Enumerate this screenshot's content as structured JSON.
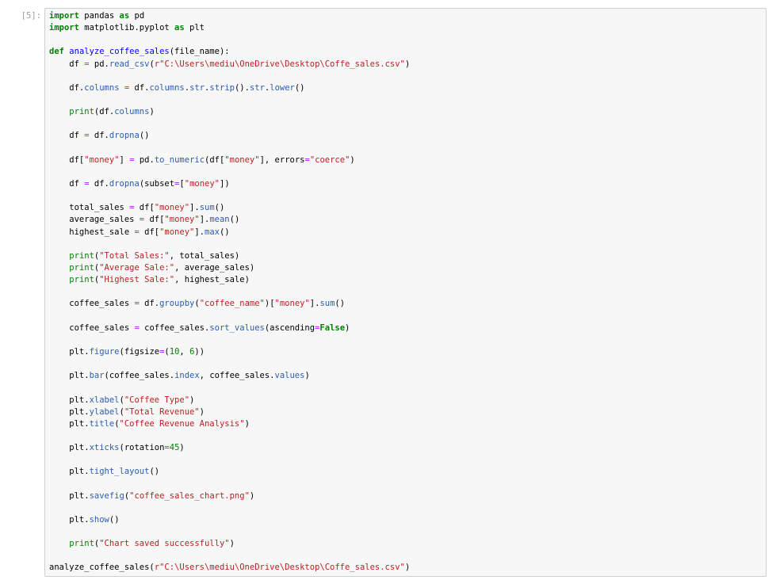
{
  "cell": {
    "prompt": "[5]:",
    "lines": [
      [
        {
          "t": "kw",
          "v": "import"
        },
        {
          "t": "tx",
          "v": " pandas "
        },
        {
          "t": "kw",
          "v": "as"
        },
        {
          "t": "tx",
          "v": " pd"
        }
      ],
      [
        {
          "t": "kw",
          "v": "import"
        },
        {
          "t": "tx",
          "v": " matplotlib.pyplot "
        },
        {
          "t": "kw",
          "v": "as"
        },
        {
          "t": "tx",
          "v": " plt"
        }
      ],
      [],
      [
        {
          "t": "kw",
          "v": "def"
        },
        {
          "t": "tx",
          "v": " "
        },
        {
          "t": "fn",
          "v": "analyze_coffee_sales"
        },
        {
          "t": "tx",
          "v": "(file_name):"
        }
      ],
      [
        {
          "t": "tx",
          "v": "    df "
        },
        {
          "t": "op",
          "v": "="
        },
        {
          "t": "tx",
          "v": " pd."
        },
        {
          "t": "at",
          "v": "read_csv"
        },
        {
          "t": "tx",
          "v": "("
        },
        {
          "t": "st",
          "v": "r\"C:\\Users\\mediu\\OneDrive\\Desktop\\Coffe_sales.csv\""
        },
        {
          "t": "tx",
          "v": ")"
        }
      ],
      [],
      [
        {
          "t": "tx",
          "v": "    df."
        },
        {
          "t": "at",
          "v": "columns"
        },
        {
          "t": "tx",
          "v": " "
        },
        {
          "t": "op",
          "v": "="
        },
        {
          "t": "tx",
          "v": " df."
        },
        {
          "t": "at",
          "v": "columns"
        },
        {
          "t": "tx",
          "v": "."
        },
        {
          "t": "at",
          "v": "str"
        },
        {
          "t": "tx",
          "v": "."
        },
        {
          "t": "at",
          "v": "strip"
        },
        {
          "t": "tx",
          "v": "()."
        },
        {
          "t": "at",
          "v": "str"
        },
        {
          "t": "tx",
          "v": "."
        },
        {
          "t": "at",
          "v": "lower"
        },
        {
          "t": "tx",
          "v": "()"
        }
      ],
      [],
      [
        {
          "t": "tx",
          "v": "    "
        },
        {
          "t": "nm",
          "v": "print"
        },
        {
          "t": "tx",
          "v": "(df."
        },
        {
          "t": "at",
          "v": "columns"
        },
        {
          "t": "tx",
          "v": ")"
        }
      ],
      [],
      [
        {
          "t": "tx",
          "v": "    df "
        },
        {
          "t": "op",
          "v": "="
        },
        {
          "t": "tx",
          "v": " df."
        },
        {
          "t": "at",
          "v": "dropna"
        },
        {
          "t": "tx",
          "v": "()"
        }
      ],
      [],
      [
        {
          "t": "tx",
          "v": "    df["
        },
        {
          "t": "st",
          "v": "\"money\""
        },
        {
          "t": "tx",
          "v": "] "
        },
        {
          "t": "op",
          "v": "="
        },
        {
          "t": "tx",
          "v": " pd."
        },
        {
          "t": "at",
          "v": "to_numeric"
        },
        {
          "t": "tx",
          "v": "(df["
        },
        {
          "t": "st",
          "v": "\"money\""
        },
        {
          "t": "tx",
          "v": "], errors"
        },
        {
          "t": "op",
          "v": "="
        },
        {
          "t": "st",
          "v": "\"coerce\""
        },
        {
          "t": "tx",
          "v": ")"
        }
      ],
      [],
      [
        {
          "t": "tx",
          "v": "    df "
        },
        {
          "t": "op",
          "v": "="
        },
        {
          "t": "tx",
          "v": " df."
        },
        {
          "t": "at",
          "v": "dropna"
        },
        {
          "t": "tx",
          "v": "(subset"
        },
        {
          "t": "op",
          "v": "="
        },
        {
          "t": "tx",
          "v": "["
        },
        {
          "t": "st",
          "v": "\"money\""
        },
        {
          "t": "tx",
          "v": "])"
        }
      ],
      [],
      [
        {
          "t": "tx",
          "v": "    total_sales "
        },
        {
          "t": "op",
          "v": "="
        },
        {
          "t": "tx",
          "v": " df["
        },
        {
          "t": "st",
          "v": "\"money\""
        },
        {
          "t": "tx",
          "v": "]."
        },
        {
          "t": "at",
          "v": "sum"
        },
        {
          "t": "tx",
          "v": "()"
        }
      ],
      [
        {
          "t": "tx",
          "v": "    average_sales "
        },
        {
          "t": "op",
          "v": "="
        },
        {
          "t": "tx",
          "v": " df["
        },
        {
          "t": "st",
          "v": "\"money\""
        },
        {
          "t": "tx",
          "v": "]."
        },
        {
          "t": "at",
          "v": "mean"
        },
        {
          "t": "tx",
          "v": "()"
        }
      ],
      [
        {
          "t": "tx",
          "v": "    highest_sale "
        },
        {
          "t": "op",
          "v": "="
        },
        {
          "t": "tx",
          "v": " df["
        },
        {
          "t": "st",
          "v": "\"money\""
        },
        {
          "t": "tx",
          "v": "]."
        },
        {
          "t": "at",
          "v": "max"
        },
        {
          "t": "tx",
          "v": "()"
        }
      ],
      [],
      [
        {
          "t": "tx",
          "v": "    "
        },
        {
          "t": "nm",
          "v": "print"
        },
        {
          "t": "tx",
          "v": "("
        },
        {
          "t": "st",
          "v": "\"Total Sales:\""
        },
        {
          "t": "tx",
          "v": ", total_sales)"
        }
      ],
      [
        {
          "t": "tx",
          "v": "    "
        },
        {
          "t": "nm",
          "v": "print"
        },
        {
          "t": "tx",
          "v": "("
        },
        {
          "t": "st",
          "v": "\"Average Sale:\""
        },
        {
          "t": "tx",
          "v": ", average_sales)"
        }
      ],
      [
        {
          "t": "tx",
          "v": "    "
        },
        {
          "t": "nm",
          "v": "print"
        },
        {
          "t": "tx",
          "v": "("
        },
        {
          "t": "st",
          "v": "\"Highest Sale:\""
        },
        {
          "t": "tx",
          "v": ", highest_sale)"
        }
      ],
      [],
      [
        {
          "t": "tx",
          "v": "    coffee_sales "
        },
        {
          "t": "op",
          "v": "="
        },
        {
          "t": "tx",
          "v": " df."
        },
        {
          "t": "at",
          "v": "groupby"
        },
        {
          "t": "tx",
          "v": "("
        },
        {
          "t": "st",
          "v": "\"coffee_name\""
        },
        {
          "t": "tx",
          "v": ")["
        },
        {
          "t": "st",
          "v": "\"money\""
        },
        {
          "t": "tx",
          "v": "]."
        },
        {
          "t": "at",
          "v": "sum"
        },
        {
          "t": "tx",
          "v": "()"
        }
      ],
      [],
      [
        {
          "t": "tx",
          "v": "    coffee_sales "
        },
        {
          "t": "op",
          "v": "="
        },
        {
          "t": "tx",
          "v": " coffee_sales."
        },
        {
          "t": "at",
          "v": "sort_values"
        },
        {
          "t": "tx",
          "v": "(ascending"
        },
        {
          "t": "op",
          "v": "="
        },
        {
          "t": "kw",
          "v": "False"
        },
        {
          "t": "tx",
          "v": ")"
        }
      ],
      [],
      [
        {
          "t": "tx",
          "v": "    plt."
        },
        {
          "t": "at",
          "v": "figure"
        },
        {
          "t": "tx",
          "v": "(figsize"
        },
        {
          "t": "op",
          "v": "="
        },
        {
          "t": "tx",
          "v": "("
        },
        {
          "t": "nm",
          "v": "10"
        },
        {
          "t": "tx",
          "v": ", "
        },
        {
          "t": "nm",
          "v": "6"
        },
        {
          "t": "tx",
          "v": "))"
        }
      ],
      [],
      [
        {
          "t": "tx",
          "v": "    plt."
        },
        {
          "t": "at",
          "v": "bar"
        },
        {
          "t": "tx",
          "v": "(coffee_sales."
        },
        {
          "t": "at",
          "v": "index"
        },
        {
          "t": "tx",
          "v": ", coffee_sales."
        },
        {
          "t": "at",
          "v": "values"
        },
        {
          "t": "tx",
          "v": ")"
        }
      ],
      [],
      [
        {
          "t": "tx",
          "v": "    plt."
        },
        {
          "t": "at",
          "v": "xlabel"
        },
        {
          "t": "tx",
          "v": "("
        },
        {
          "t": "st",
          "v": "\"Coffee Type\""
        },
        {
          "t": "tx",
          "v": ")"
        }
      ],
      [
        {
          "t": "tx",
          "v": "    plt."
        },
        {
          "t": "at",
          "v": "ylabel"
        },
        {
          "t": "tx",
          "v": "("
        },
        {
          "t": "st",
          "v": "\"Total Revenue\""
        },
        {
          "t": "tx",
          "v": ")"
        }
      ],
      [
        {
          "t": "tx",
          "v": "    plt."
        },
        {
          "t": "at",
          "v": "title"
        },
        {
          "t": "tx",
          "v": "("
        },
        {
          "t": "st",
          "v": "\"Coffee Revenue Analysis\""
        },
        {
          "t": "tx",
          "v": ")"
        }
      ],
      [],
      [
        {
          "t": "tx",
          "v": "    plt."
        },
        {
          "t": "at",
          "v": "xticks"
        },
        {
          "t": "tx",
          "v": "(rotation"
        },
        {
          "t": "op",
          "v": "="
        },
        {
          "t": "nm",
          "v": "45"
        },
        {
          "t": "tx",
          "v": ")"
        }
      ],
      [],
      [
        {
          "t": "tx",
          "v": "    plt."
        },
        {
          "t": "at",
          "v": "tight_layout"
        },
        {
          "t": "tx",
          "v": "()"
        }
      ],
      [],
      [
        {
          "t": "tx",
          "v": "    plt."
        },
        {
          "t": "at",
          "v": "savefig"
        },
        {
          "t": "tx",
          "v": "("
        },
        {
          "t": "st",
          "v": "\"coffee_sales_chart.png\""
        },
        {
          "t": "tx",
          "v": ")"
        }
      ],
      [],
      [
        {
          "t": "tx",
          "v": "    plt."
        },
        {
          "t": "at",
          "v": "show"
        },
        {
          "t": "tx",
          "v": "()"
        }
      ],
      [],
      [
        {
          "t": "tx",
          "v": "    "
        },
        {
          "t": "nm",
          "v": "print"
        },
        {
          "t": "tx",
          "v": "("
        },
        {
          "t": "st",
          "v": "\"Chart saved successfully\""
        },
        {
          "t": "tx",
          "v": ")"
        }
      ],
      [],
      [
        {
          "t": "tx",
          "v": "analyze_coffee_sales("
        },
        {
          "t": "st",
          "v": "r\"C:\\Users\\mediu\\OneDrive\\Desktop\\Coffe_sales.csv\""
        },
        {
          "t": "tx",
          "v": ")"
        }
      ]
    ]
  }
}
